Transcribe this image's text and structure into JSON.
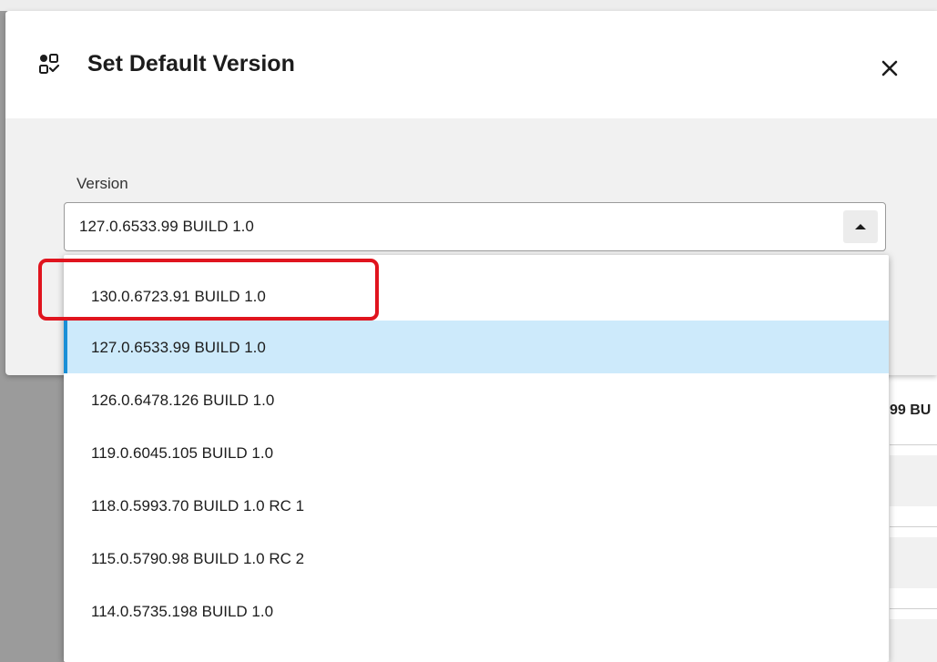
{
  "dialog": {
    "title": "Set Default Version",
    "icon": "version-grid-icon",
    "close_icon": "close-icon"
  },
  "field": {
    "label": "Version",
    "selected_value": "127.0.6533.99 BUILD 1.0",
    "arrow_icon": "caret-up-icon"
  },
  "dropdown": {
    "options": [
      "130.0.6723.91 BUILD 1.0",
      "127.0.6533.99 BUILD 1.0",
      "126.0.6478.126 BUILD 1.0",
      "119.0.6045.105 BUILD 1.0",
      "118.0.5993.70 BUILD 1.0 RC 1",
      "115.0.5790.98 BUILD 1.0 RC 2",
      "114.0.5735.198 BUILD 1.0"
    ],
    "selected_index": 1
  },
  "background": {
    "partial_text": "99 BU"
  },
  "colors": {
    "accent": "#1a8fd6",
    "selected_bg": "#cdeafb",
    "annotation": "#e0141e"
  }
}
